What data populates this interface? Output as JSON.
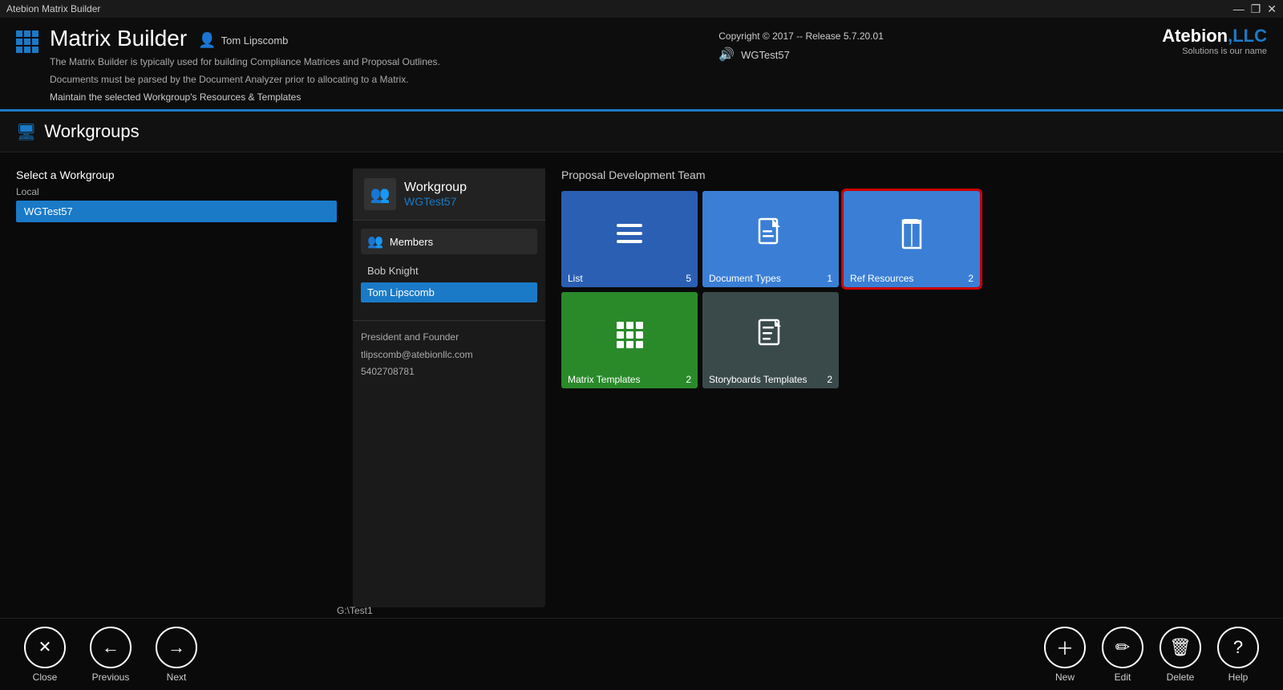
{
  "titlebar": {
    "app_title": "Atebion Matrix Builder",
    "controls": [
      "—",
      "❐",
      "✕"
    ]
  },
  "header": {
    "app_name": "Matrix Builder",
    "user_icon": "👤",
    "user_name": "Tom Lipscomb",
    "copyright": "Copyright © 2017 -- Release 5.7.20.01",
    "wg_icon": "🔊",
    "wg_name": "WGTest57",
    "desc_line1": "The Matrix Builder is typically used for building Compliance Matrices and Proposal Outlines.",
    "desc_line2": "Documents must be parsed by the Document Analyzer prior to allocating to a Matrix.",
    "subtitle": "Maintain the selected Workgroup's Resources & Templates",
    "logo_name": "Atebion",
    "logo_suffix": ",LLC",
    "logo_sub": "Solutions is our name"
  },
  "section": {
    "title": "Workgroups"
  },
  "left_panel": {
    "select_label": "Select a Workgroup",
    "local_label": "Local",
    "items": [
      {
        "label": "WGTest57",
        "selected": true
      }
    ]
  },
  "workgroup": {
    "header_label": "Workgroup",
    "name": "WGTest57",
    "members_label": "Members",
    "members": [
      {
        "name": "Bob Knight",
        "selected": false
      },
      {
        "name": "Tom Lipscomb",
        "selected": true
      }
    ],
    "detail_title": "President and Founder",
    "detail_email": "tlipscomb@atebionllc.com",
    "detail_phone": "5402708781"
  },
  "proposal": {
    "label": "Proposal Development Team"
  },
  "tiles": [
    {
      "id": "list",
      "label": "List",
      "count": "5",
      "icon": "list",
      "color": "blue",
      "selected": false
    },
    {
      "id": "document-types",
      "label": "Document Types",
      "count": "1",
      "icon": "document",
      "color": "blue2",
      "selected": false
    },
    {
      "id": "ref-resources",
      "label": "Ref Resources",
      "count": "2",
      "icon": "book",
      "color": "red-border",
      "selected": true
    },
    {
      "id": "matrix-templates",
      "label": "Matrix Templates",
      "count": "2",
      "icon": "grid",
      "color": "green",
      "selected": false
    },
    {
      "id": "storyboards-templates",
      "label": "Storyboards Templates",
      "count": "2",
      "icon": "file-text",
      "color": "dark",
      "selected": false
    }
  ],
  "footer": {
    "path": "G:\\Test1",
    "close_label": "Close",
    "previous_label": "Previous",
    "next_label": "Next",
    "new_label": "New",
    "edit_label": "Edit",
    "delete_label": "Delete",
    "help_label": "Help"
  }
}
